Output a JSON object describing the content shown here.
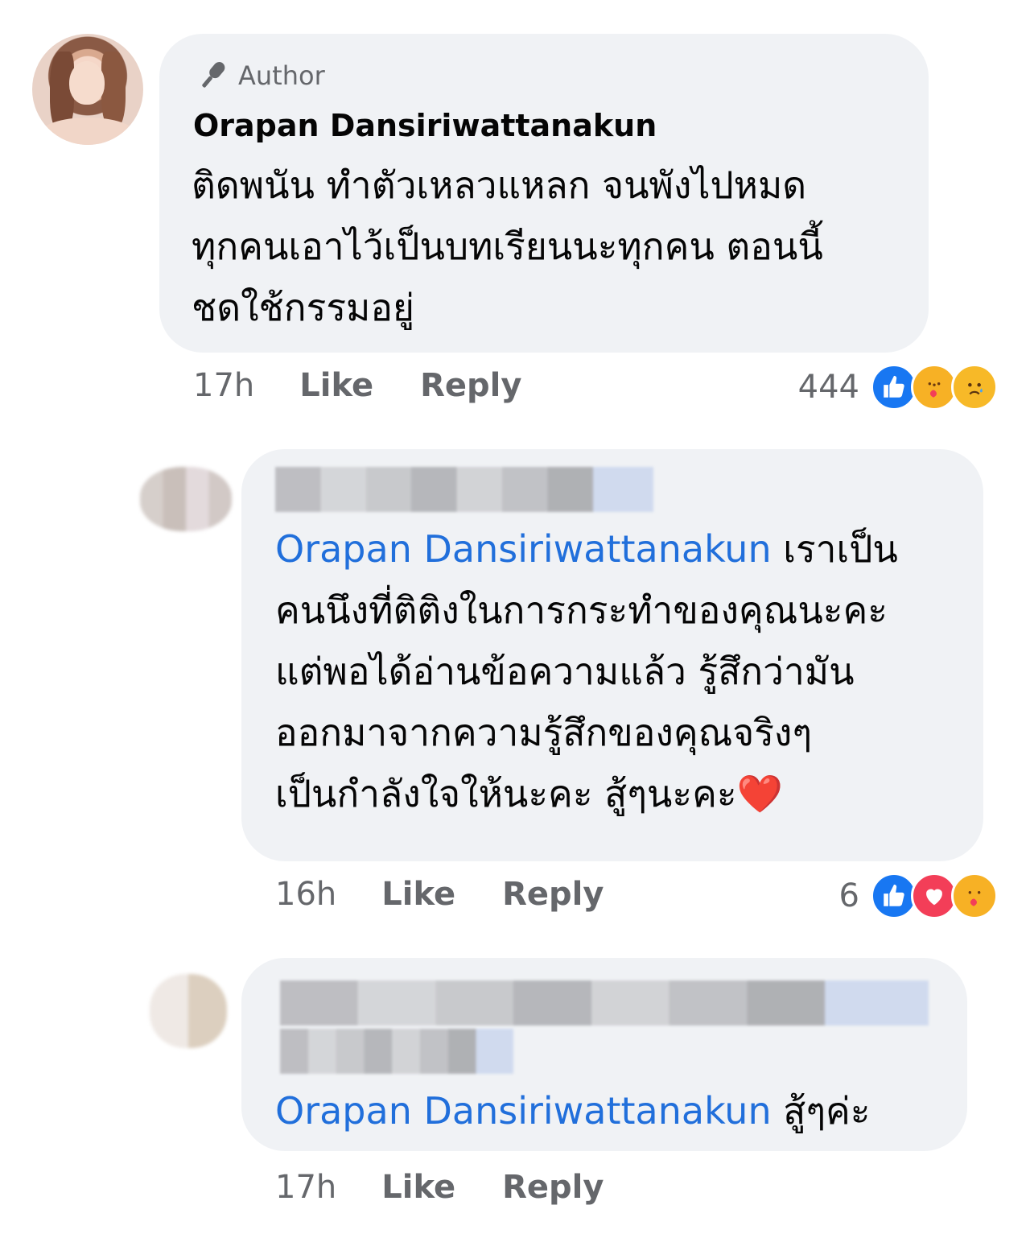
{
  "comment_main": {
    "author_label": "Author",
    "name": "Orapan Dansiriwattanakun",
    "text_lines": [
      "ติดพนัน ทำตัวเหลวแหลก จนพังไปหมด",
      "ทุกคนเอาไว้เป็นบทเรียนนะทุกคน ตอนนี้",
      "ชดใช้กรรมอยู่"
    ],
    "time": "17h",
    "like_label": "Like",
    "reply_label": "Reply",
    "reaction_count": "444",
    "reactions": [
      "like-icon",
      "care-icon",
      "sad-icon"
    ]
  },
  "reply_1": {
    "mention": "Orapan Dansiriwattanakun",
    "first_line_rest": " เราเป็น",
    "text_lines": [
      "คนนึงที่ติติงในการกระทำของคุณนะคะ",
      "แต่พอได้อ่านข้อความแล้ว รู้สึกว่ามัน",
      "ออกมาจากความรู้สึกของคุณจริงๆ",
      "เป็นกำลังใจให้นะคะ สู้ๆนะคะ❤️"
    ],
    "time": "16h",
    "like_label": "Like",
    "reply_label": "Reply",
    "reaction_count": "6",
    "reactions": [
      "like-icon",
      "love-icon",
      "care-icon"
    ]
  },
  "reply_2": {
    "mention": "Orapan Dansiriwattanakun",
    "text_rest": " สู้ๆค่ะ",
    "time": "17h",
    "like_label": "Like",
    "reply_label": "Reply"
  }
}
